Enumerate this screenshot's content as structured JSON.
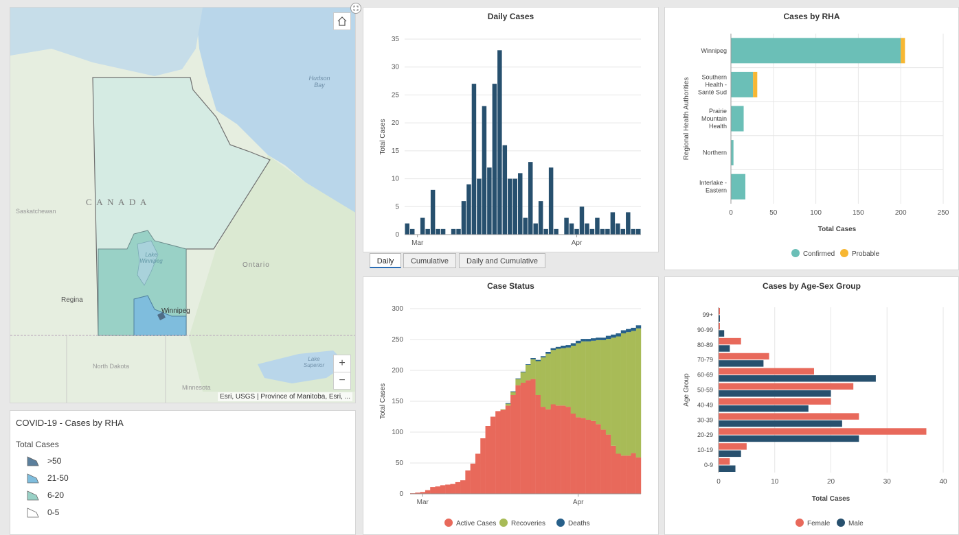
{
  "map": {
    "labels": {
      "hudson_bay": "Hudson Bay",
      "canada": "C A N A D A",
      "saskatchewan": "Saskatchewan",
      "lake_winnipeg": "Lake Winnipeg",
      "ontario": "Ontario",
      "regina": "Regina",
      "winnipeg": "Winnipeg",
      "north_dakota": "North Dakota",
      "minnesota": "Minnesota",
      "lake_superior": "Lake Superior"
    },
    "attribution": "Esri, USGS | Province of Manitoba, Esri, ...",
    "zoom_in": "+",
    "zoom_out": "−",
    "home_icon": "home-icon",
    "colors": {
      "water": "#b9d6ea",
      "land": "#e6eee0",
      "province": "#d5ebe3",
      "rha_mid": "#99d1c6",
      "rha_high": "#7fbddd"
    }
  },
  "legend": {
    "title": "COVID-19 - Cases by RHA",
    "subtitle": "Total Cases",
    "items": [
      {
        "label": ">50",
        "color": "#5b7f9c"
      },
      {
        "label": "21-50",
        "color": "#7fbddd"
      },
      {
        "label": "6-20",
        "color": "#99d1c6"
      },
      {
        "label": "0-5",
        "color": "#ffffff"
      }
    ]
  },
  "tabs": [
    {
      "label": "Daily",
      "active": true
    },
    {
      "label": "Cumulative",
      "active": false
    },
    {
      "label": "Daily and Cumulative",
      "active": false
    }
  ],
  "charts": {
    "daily": {
      "title": "Daily Cases",
      "ylabel": "Total Cases"
    },
    "rha": {
      "title": "Cases by RHA",
      "ylabel": "Regional Health Authorities",
      "xlabel": "Total Cases"
    },
    "status": {
      "title": "Case Status",
      "ylabel": "Total Cases"
    },
    "agesex": {
      "title": "Cases by Age-Sex Group",
      "ylabel": "Age Group",
      "xlabel": "Total Cases"
    }
  },
  "chart_data": [
    {
      "id": "daily",
      "type": "bar",
      "title": "Daily Cases",
      "ylabel": "Total Cases",
      "ylim": [
        0,
        35
      ],
      "yticks": [
        0,
        5,
        10,
        15,
        20,
        25,
        30,
        35
      ],
      "x_tick_labels": [
        {
          "label": "Mar",
          "index": 2
        },
        {
          "label": "Apr",
          "index": 33
        }
      ],
      "values": [
        2,
        1,
        0,
        3,
        1,
        8,
        1,
        1,
        0,
        1,
        1,
        6,
        9,
        27,
        10,
        23,
        12,
        27,
        33,
        16,
        10,
        10,
        11,
        3,
        13,
        2,
        6,
        1,
        12,
        1,
        0,
        3,
        2,
        1,
        5,
        2,
        1,
        3,
        1,
        1,
        4,
        2,
        1,
        4,
        1,
        1
      ],
      "color": "#27506e",
      "grid": true
    },
    {
      "id": "rha",
      "type": "bar",
      "orientation": "horizontal",
      "title": "Cases by RHA",
      "xlabel": "Total Cases",
      "ylabel": "Regional Health Authorities",
      "xlim": [
        0,
        250
      ],
      "xticks": [
        0,
        50,
        100,
        150,
        200,
        250
      ],
      "categories": [
        "Winnipeg",
        "Southern Health - Santé Sud",
        "Prairie Mountain Health",
        "Northern",
        "Interlake - Eastern"
      ],
      "category_lines": [
        [
          "Winnipeg"
        ],
        [
          "Southern",
          "Health -",
          "Santé Sud"
        ],
        [
          "Prairie",
          "Mountain",
          "Health"
        ],
        [
          "Northern"
        ],
        [
          "Interlake -",
          "Eastern"
        ]
      ],
      "series": [
        {
          "name": "Confirmed",
          "color": "#6bbfb7",
          "values": [
            200,
            26,
            15,
            3,
            17
          ]
        },
        {
          "name": "Probable",
          "color": "#f7b733",
          "values": [
            5,
            5,
            0,
            0,
            0
          ]
        }
      ],
      "legend": "bottom"
    },
    {
      "id": "status",
      "type": "area",
      "stacked": true,
      "title": "Case Status",
      "ylabel": "Total Cases",
      "ylim": [
        0,
        300
      ],
      "yticks": [
        0,
        50,
        100,
        150,
        200,
        250,
        300
      ],
      "x_tick_labels": [
        {
          "label": "Mar",
          "index": 2
        },
        {
          "label": "Apr",
          "index": 33
        }
      ],
      "series": [
        {
          "name": "Active Cases",
          "color": "#e8695b",
          "values": [
            1,
            2,
            3,
            6,
            11,
            12,
            14,
            15,
            16,
            19,
            22,
            38,
            49,
            65,
            90,
            110,
            125,
            134,
            136,
            143,
            160,
            176,
            180,
            184,
            186,
            160,
            141,
            137,
            145,
            143,
            143,
            141,
            130,
            124,
            123,
            120,
            118,
            113,
            104,
            96,
            78,
            65,
            62,
            62,
            66,
            59
          ]
        },
        {
          "name": "Recoveries",
          "color": "#a8bb57",
          "values": [
            0,
            0,
            0,
            0,
            0,
            0,
            0,
            0,
            0,
            0,
            0,
            0,
            0,
            0,
            0,
            0,
            0,
            0,
            1,
            3,
            5,
            10,
            17,
            25,
            32,
            55,
            80,
            90,
            88,
            92,
            93,
            96,
            110,
            120,
            124,
            127,
            130,
            136,
            145,
            155,
            175,
            190,
            198,
            200,
            198,
            209
          ]
        },
        {
          "name": "Deaths",
          "color": "#27608a",
          "values": [
            0,
            0,
            0,
            0,
            0,
            0,
            0,
            0,
            0,
            0,
            0,
            0,
            0,
            0,
            0,
            0,
            0,
            0,
            0,
            1,
            1,
            1,
            1,
            1,
            2,
            2,
            2,
            3,
            3,
            3,
            4,
            4,
            4,
            4,
            4,
            4,
            4,
            4,
            4,
            5,
            5,
            5,
            5,
            5,
            5,
            5
          ]
        }
      ],
      "legend": "bottom"
    },
    {
      "id": "agesex",
      "type": "bar",
      "orientation": "horizontal",
      "title": "Cases by Age-Sex Group",
      "xlabel": "Total Cases",
      "ylabel": "Age Group",
      "xlim": [
        0,
        40
      ],
      "xticks": [
        0,
        10,
        20,
        30,
        40
      ],
      "categories": [
        "99+",
        "90-99",
        "80-89",
        "70-79",
        "60-69",
        "50-59",
        "40-49",
        "30-39",
        "20-29",
        "10-19",
        "0-9"
      ],
      "series": [
        {
          "name": "Female",
          "color": "#e8695b",
          "values": [
            0,
            0,
            4,
            9,
            17,
            24,
            20,
            25,
            37,
            5,
            2
          ]
        },
        {
          "name": "Male",
          "color": "#27506e",
          "values": [
            0,
            1,
            2,
            8,
            28,
            20,
            16,
            22,
            25,
            4,
            3
          ]
        }
      ],
      "legend": "bottom"
    }
  ]
}
